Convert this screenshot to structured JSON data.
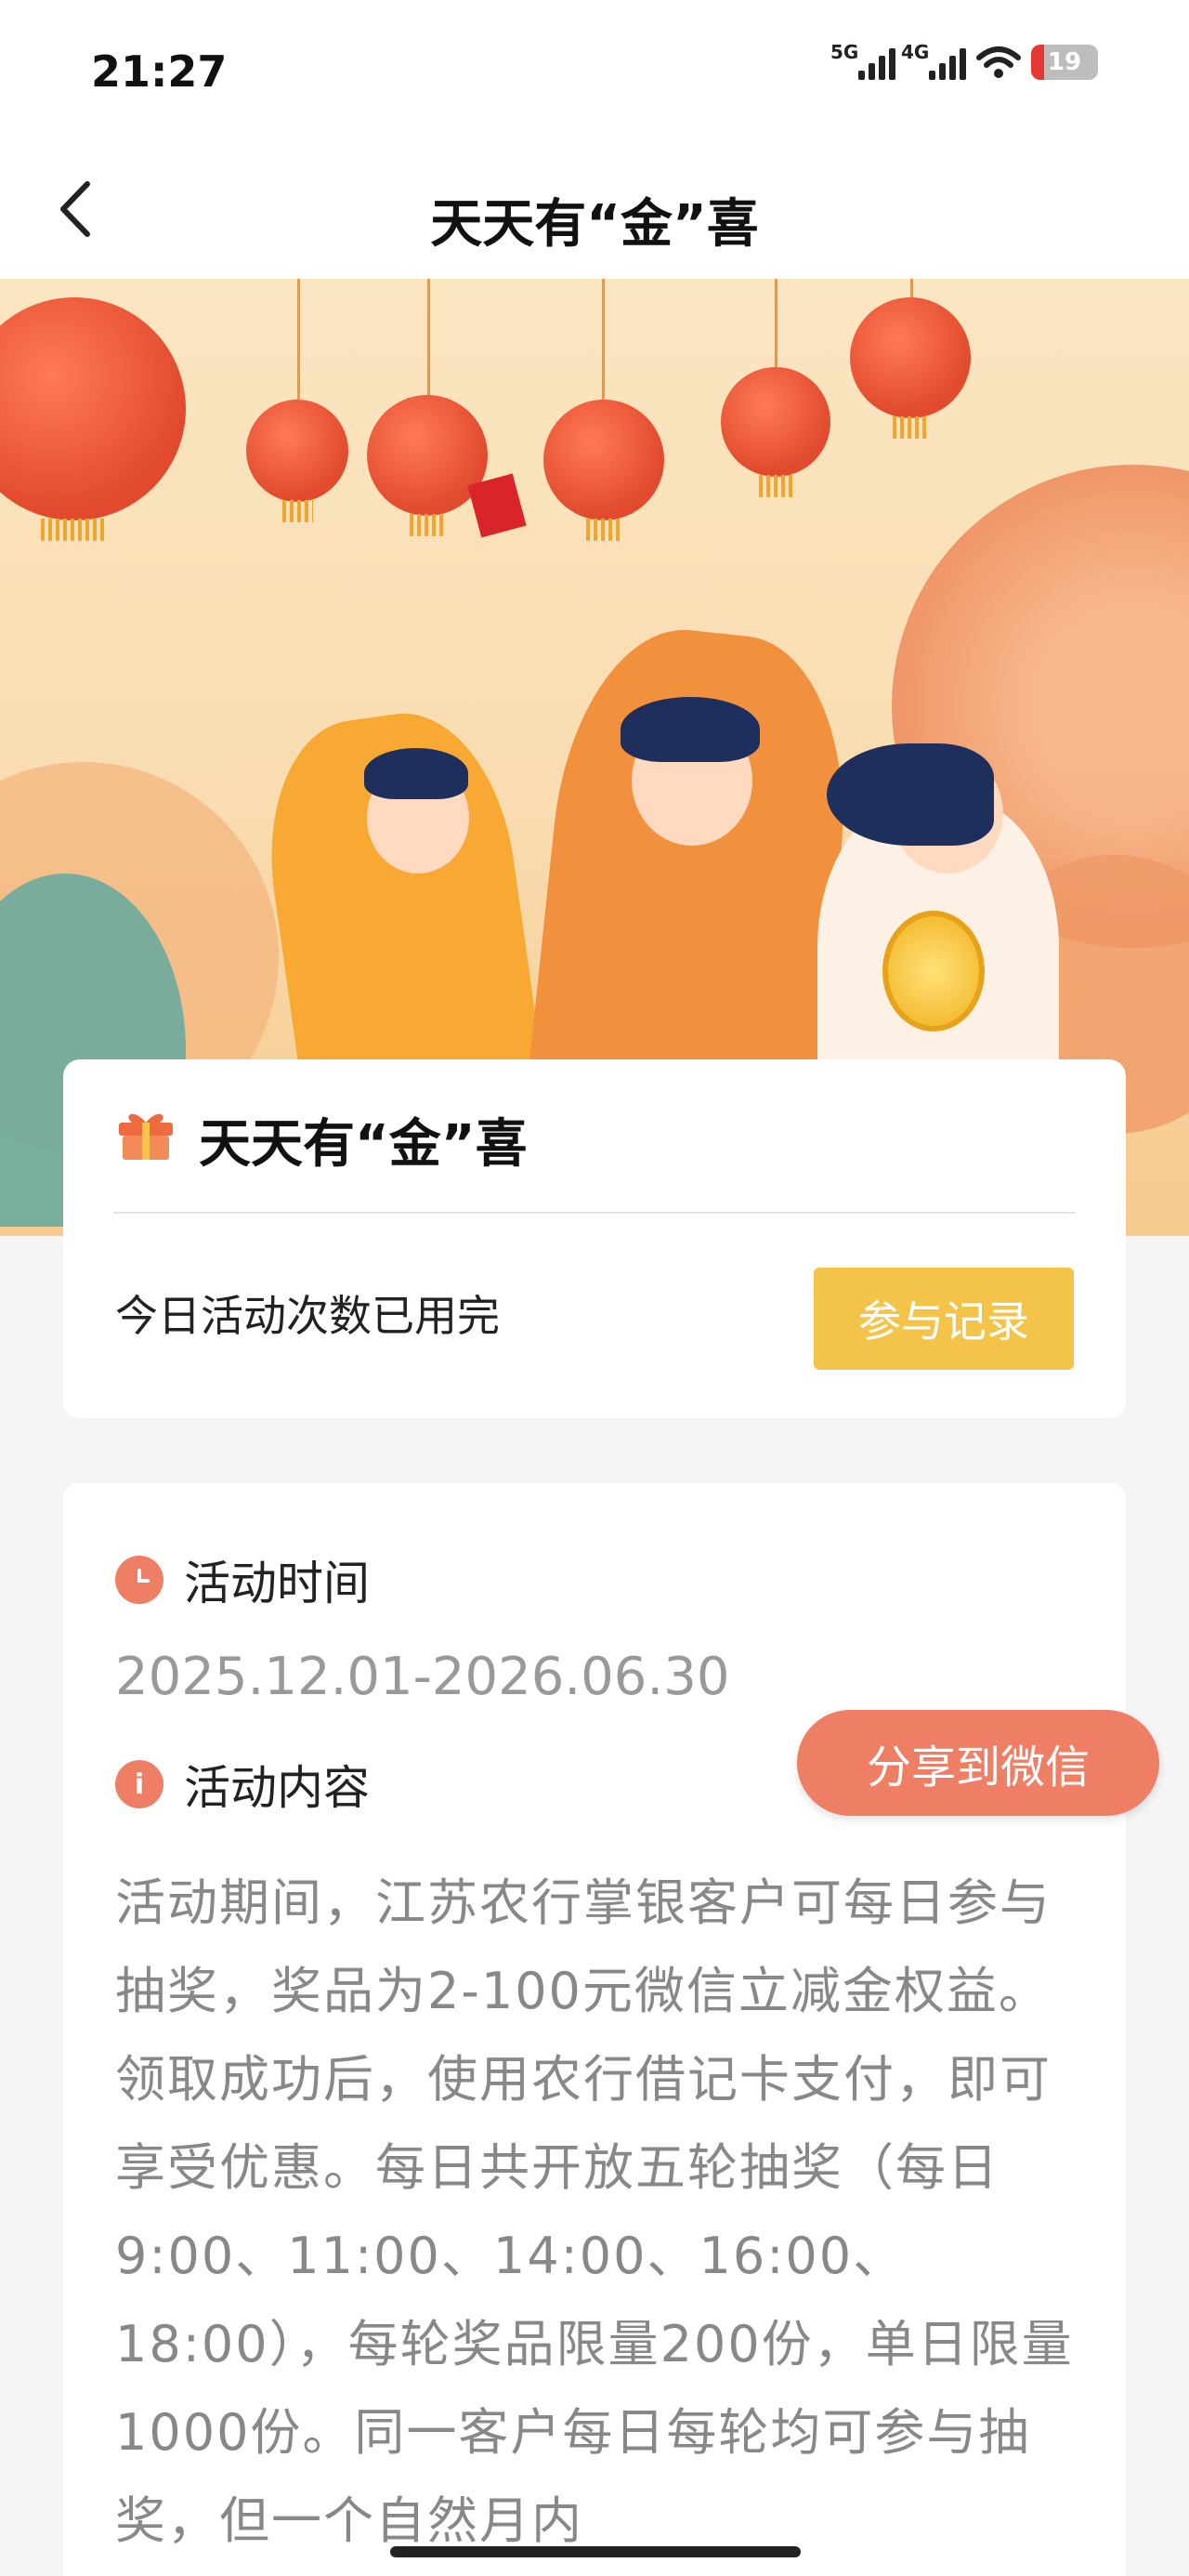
{
  "status_bar": {
    "time": "21:27",
    "net1": "5G",
    "net2": "4G",
    "battery": "19"
  },
  "nav": {
    "title": "天天有“金”喜"
  },
  "card": {
    "title": "天天有“金”喜",
    "status_text": "今日活动次数已用完",
    "record_button": "参与记录"
  },
  "info": {
    "time_label": "活动时间",
    "date_range": "2025.12.01-2026.06.30",
    "content_label": "活动内容",
    "content_icon": "i",
    "description": "活动期间，江苏农行掌银客户可每日参与抽奖，奖品为2-100元微信立减金权益。领取成功后，使用农行借记卡支付，即可享受优惠。每日共开放五轮抽奖（每日9:00、11:00、14:00、16:00、18:00），每轮奖品限量200份，单日限量1000份。同一客户每日每轮均可参与抽奖，但一个自然月内"
  },
  "share_button": "分享到微信",
  "colors": {
    "accent_orange": "#ee7e64",
    "button_yellow": "#f4c44a"
  }
}
